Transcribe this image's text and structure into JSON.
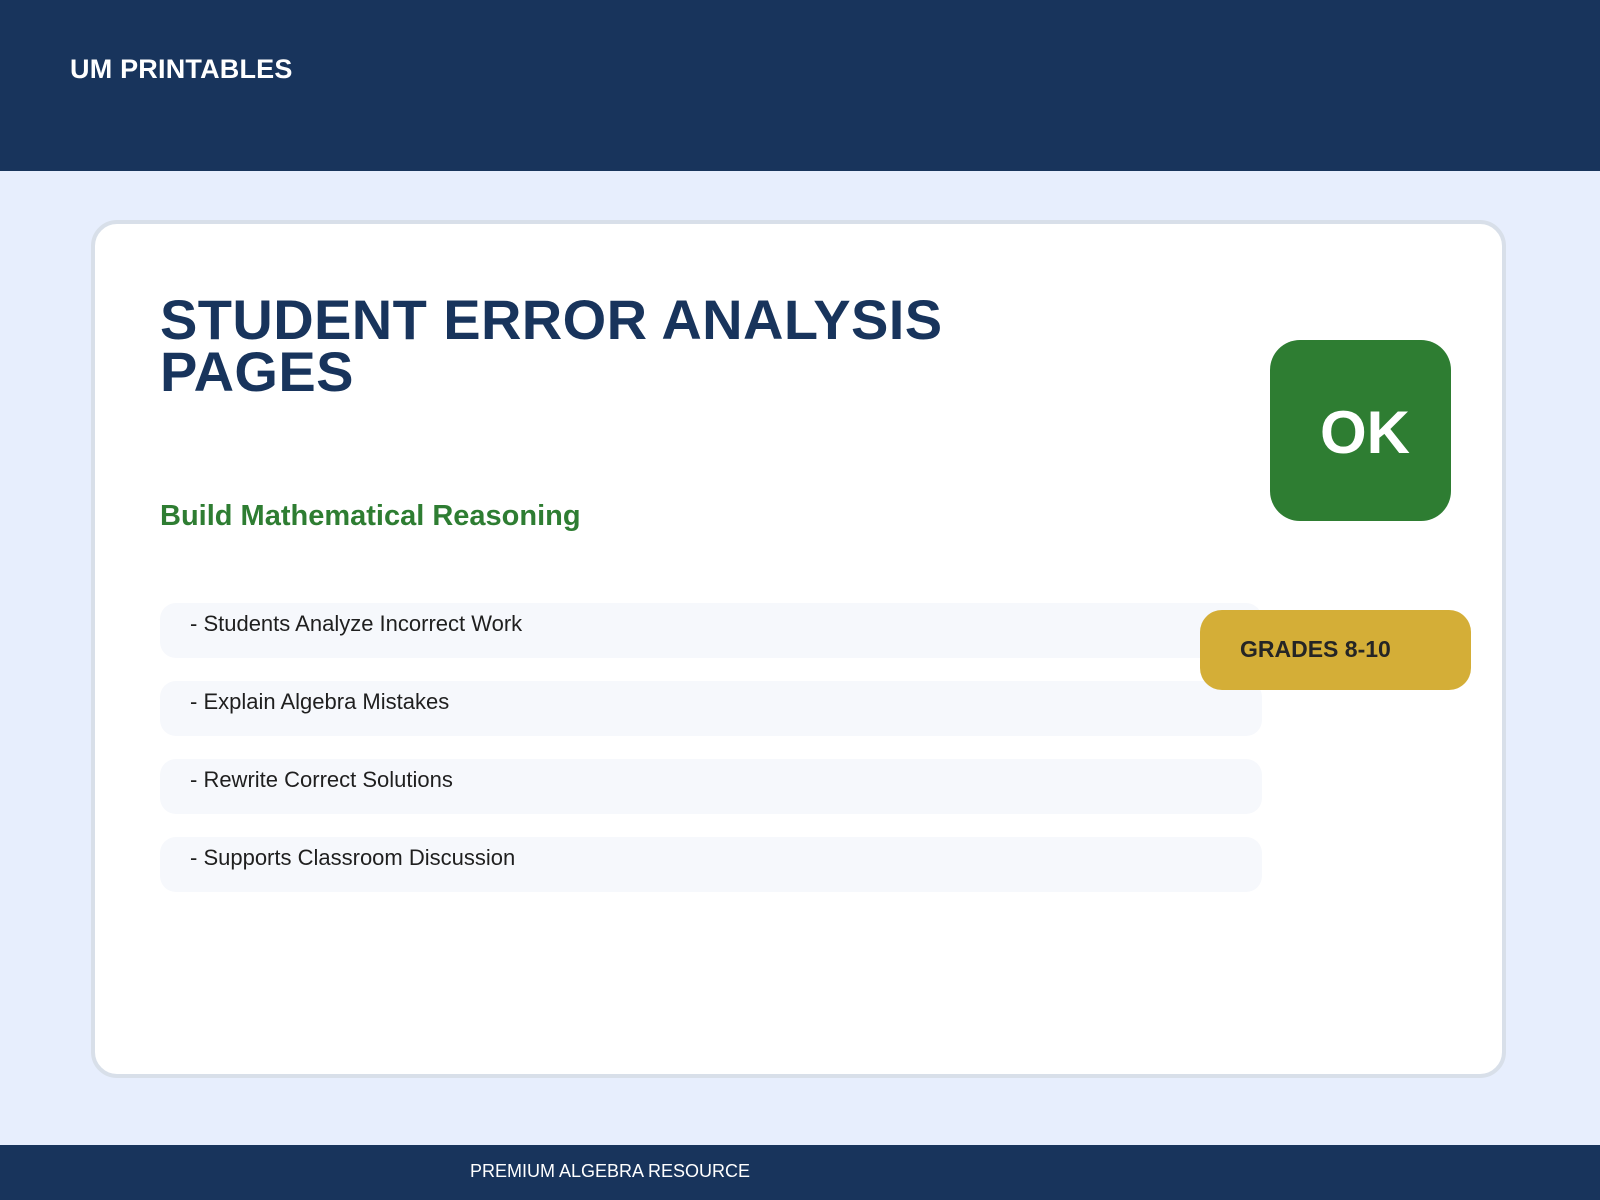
{
  "header": {
    "brand": "UM PRINTABLES"
  },
  "card": {
    "title": "STUDENT ERROR ANALYSIS PAGES",
    "subtitle": "Build Mathematical Reasoning",
    "features": [
      "- Students Analyze Incorrect Work",
      "- Explain Algebra Mistakes",
      "- Rewrite Correct Solutions",
      "- Supports Classroom Discussion"
    ],
    "ok_badge": "OK",
    "grades_badge": "GRADES 8-10"
  },
  "footer": {
    "text": "PREMIUM ALGEBRA RESOURCE"
  },
  "colors": {
    "navy": "#18345c",
    "page_background": "#e7eefd",
    "green": "#2e7d32",
    "gold": "#d4ae37"
  }
}
